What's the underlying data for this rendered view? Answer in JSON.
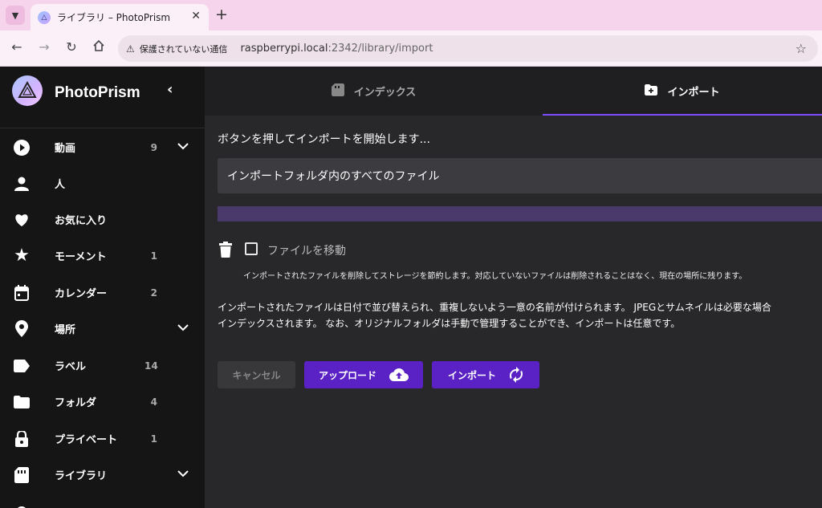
{
  "browser": {
    "tab_title": "ライブラリ – PhotoPrism",
    "security_label": "保護されていない通信",
    "url_host": "raspberrypi.local",
    "url_path": ":2342/library/import"
  },
  "sidebar": {
    "brand": "PhotoPrism",
    "items": [
      {
        "label": "動画",
        "count": "9",
        "icon": "play-circle-icon",
        "expandable": true
      },
      {
        "label": "人",
        "count": "",
        "icon": "person-icon",
        "expandable": false
      },
      {
        "label": "お気に入り",
        "count": "",
        "icon": "heart-icon",
        "expandable": false
      },
      {
        "label": "モーメント",
        "count": "1",
        "icon": "star-icon",
        "expandable": false
      },
      {
        "label": "カレンダー",
        "count": "2",
        "icon": "calendar-icon",
        "expandable": false
      },
      {
        "label": "場所",
        "count": "",
        "icon": "location-pin-icon",
        "expandable": true
      },
      {
        "label": "ラベル",
        "count": "14",
        "icon": "label-icon",
        "expandable": false
      },
      {
        "label": "フォルダ",
        "count": "4",
        "icon": "folder-icon",
        "expandable": false
      },
      {
        "label": "プライベート",
        "count": "1",
        "icon": "lock-icon",
        "expandable": false
      },
      {
        "label": "ライブラリ",
        "count": "",
        "icon": "library-icon",
        "expandable": true
      }
    ]
  },
  "tabs": [
    {
      "label": "インデックス",
      "icon": "index-folder-icon",
      "active": false
    },
    {
      "label": "インポート",
      "icon": "import-folder-icon",
      "active": true
    }
  ],
  "import": {
    "intro": "ボタンを押してインポートを開始します...",
    "folder_select_value": "インポートフォルダ内のすべてのファイル",
    "move_files_label": "ファイルを移動",
    "move_files_checked": false,
    "move_files_hint": "インポートされたファイルを削除してストレージを節約します。対応していないファイルは削除されることはなく、現在の場所に残ります。",
    "description_line1": "インポートされたファイルは日付で並び替えられ、重複しないよう一意の名前が付けられます。 JPEGとサムネイルは必要な場合",
    "description_line2": "インデックスされます。 なお、オリジナルフォルダは手動で管理することができ、インポートは任意です。",
    "cancel_label": "キャンセル",
    "upload_label": "アップロード",
    "import_label": "インポート"
  },
  "colors": {
    "accent": "#5a22c4",
    "progress": "#4a3a6c",
    "tab_indicator": "#7c4dff"
  }
}
